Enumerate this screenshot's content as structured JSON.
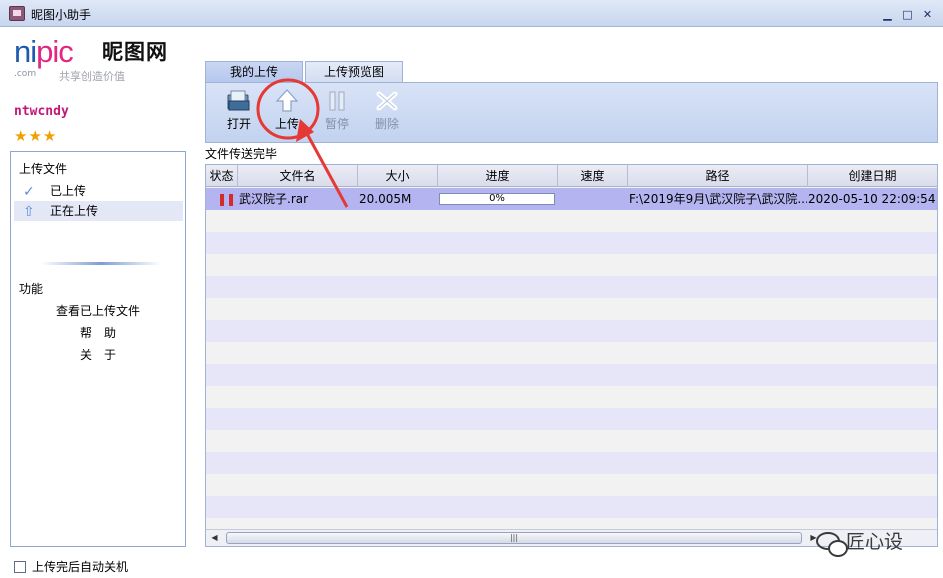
{
  "window": {
    "title": "昵图小助手",
    "minimize_glyph": "▁",
    "maximize_glyph": "□",
    "close_glyph": "✕"
  },
  "brand": {
    "logo_ni": "ni",
    "logo_pic": "pic",
    "logo_cn": "昵图网",
    "logo_com": ".com",
    "slogan": "共享创造价值",
    "username": "ntwcndy",
    "stars": "★★★",
    "star_count": 3,
    "colors": {
      "ni": "#1e5bb0",
      "pic": "#e22682",
      "username": "#c2187a"
    }
  },
  "sidebar": {
    "upload_title": "上传文件",
    "items": [
      {
        "label": "已上传",
        "icon": "check-icon",
        "glyph": "✓",
        "selected": false
      },
      {
        "label": "正在上传",
        "icon": "up-arrow-icon",
        "glyph": "⇧",
        "selected": true
      }
    ],
    "functions_title": "功能",
    "functions": [
      "查看已上传文件",
      "帮　助",
      "关　于"
    ],
    "auto_shutdown_label": "上传完后自动关机",
    "auto_shutdown_checked": false
  },
  "tabs": [
    {
      "label": "我的上传",
      "active": true
    },
    {
      "label": "上传预览图",
      "active": false
    }
  ],
  "toolbar": {
    "buttons": [
      {
        "label": "打开",
        "icon": "open-folder-icon",
        "glyph": "📂",
        "enabled": true
      },
      {
        "label": "上传",
        "icon": "upload-arrow-icon",
        "glyph": "⇧",
        "enabled": true
      },
      {
        "label": "暂停",
        "icon": "pause-icon",
        "glyph": "❚❚",
        "enabled": false
      },
      {
        "label": "删除",
        "icon": "delete-x-icon",
        "glyph": "✖",
        "enabled": false
      }
    ]
  },
  "status_text": "文件传送完毕",
  "table": {
    "columns": [
      "状态",
      "文件名",
      "大小",
      "进度",
      "速度",
      "路径",
      "创建日期"
    ],
    "rows": [
      {
        "status": "❚❚",
        "filename": "武汉院子.rar",
        "size": "20.005M",
        "progress_label": "0%",
        "progress": 0,
        "speed": "",
        "path": "F:\\2019年9月\\武汉院子\\武汉院...",
        "created": "2020-05-10 22:09:54"
      }
    ],
    "scroll_thumb_glyph": "|||",
    "scroll_left_glyph": "◀",
    "scroll_right_glyph": "▶"
  },
  "watermark": "匠心设"
}
